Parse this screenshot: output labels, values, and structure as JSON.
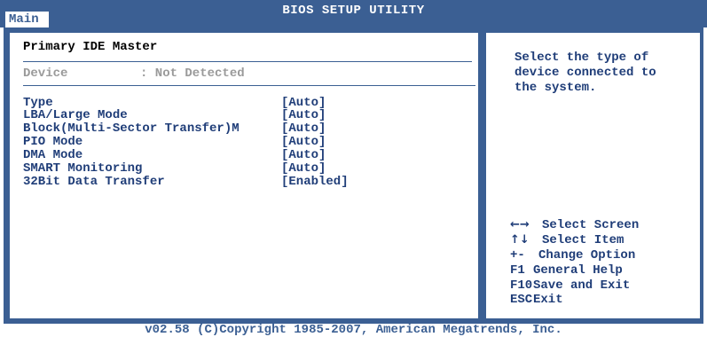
{
  "window": {
    "title": "BIOS SETUP UTILITY"
  },
  "tabs": [
    {
      "label": "Main"
    }
  ],
  "section": {
    "title": "Primary IDE Master"
  },
  "device": {
    "label": "Device",
    "value": ": Not Detected"
  },
  "options": [
    {
      "label": "Type",
      "value": "[Auto]"
    },
    {
      "label": "LBA/Large Mode",
      "value": "[Auto]"
    },
    {
      "label": "Block(Multi-Sector Transfer)M",
      "value": "[Auto]"
    },
    {
      "label": "PIO Mode",
      "value": "[Auto]"
    },
    {
      "label": "DMA Mode",
      "value": "[Auto]"
    },
    {
      "label": "SMART Monitoring",
      "value": "[Auto]"
    },
    {
      "label": "32Bit Data Transfer",
      "value": "[Enabled]"
    }
  ],
  "help": {
    "text": "Select the type of\ndevice connected to\nthe system."
  },
  "keys": [
    {
      "key": "←→",
      "action": "Select Screen",
      "icon": "left-right-arrows-icon"
    },
    {
      "key": "↑↓",
      "action": "Select Item",
      "icon": "up-down-arrows-icon"
    },
    {
      "key": "+-",
      "action": "Change Option"
    },
    {
      "key": "F1",
      "action": "General Help"
    },
    {
      "key": "F10",
      "action": "Save and Exit"
    },
    {
      "key": "ESC",
      "action": "Exit"
    }
  ],
  "footer": {
    "text": "v02.58 (C)Copyright 1985-2007, American Megatrends, Inc."
  },
  "colors": {
    "frame": "#3b5f93",
    "option_text": "#1f3d78",
    "disabled_text": "#9a9a9a"
  }
}
